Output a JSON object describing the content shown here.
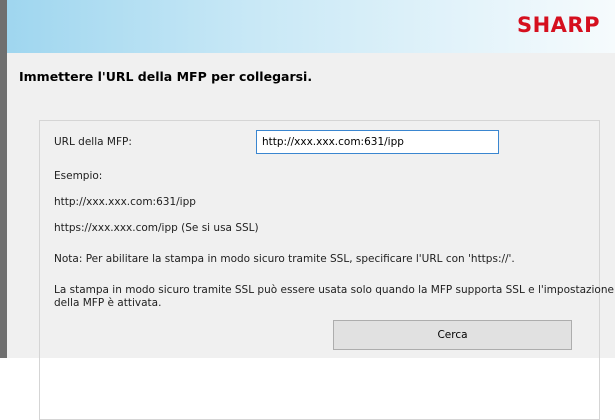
{
  "banner": {
    "logo": "SHARP"
  },
  "heading": "Immettere l'URL della MFP per collegarsi.",
  "form": {
    "url_label": "URL della MFP:",
    "url_value": "http://xxx.xxx.com:631/ipp",
    "example_label": "Esempio:",
    "example_http": "http://xxx.xxx.com:631/ipp",
    "example_https": "https://xxx.xxx.com/ipp (Se si usa SSL)",
    "note": "Nota: Per abilitare la stampa in modo sicuro tramite SSL, specificare l'URL con 'https://'.",
    "ssl_info_line1": "La stampa in modo sicuro tramite SSL può essere usata solo quando la MFP supporta SSL e l'impostazione SSL",
    "ssl_info_line2": "della MFP è attivata.",
    "search_button": "Cerca"
  },
  "colors": {
    "brand": "#d50f1e",
    "input_focus": "#3a86d0"
  }
}
